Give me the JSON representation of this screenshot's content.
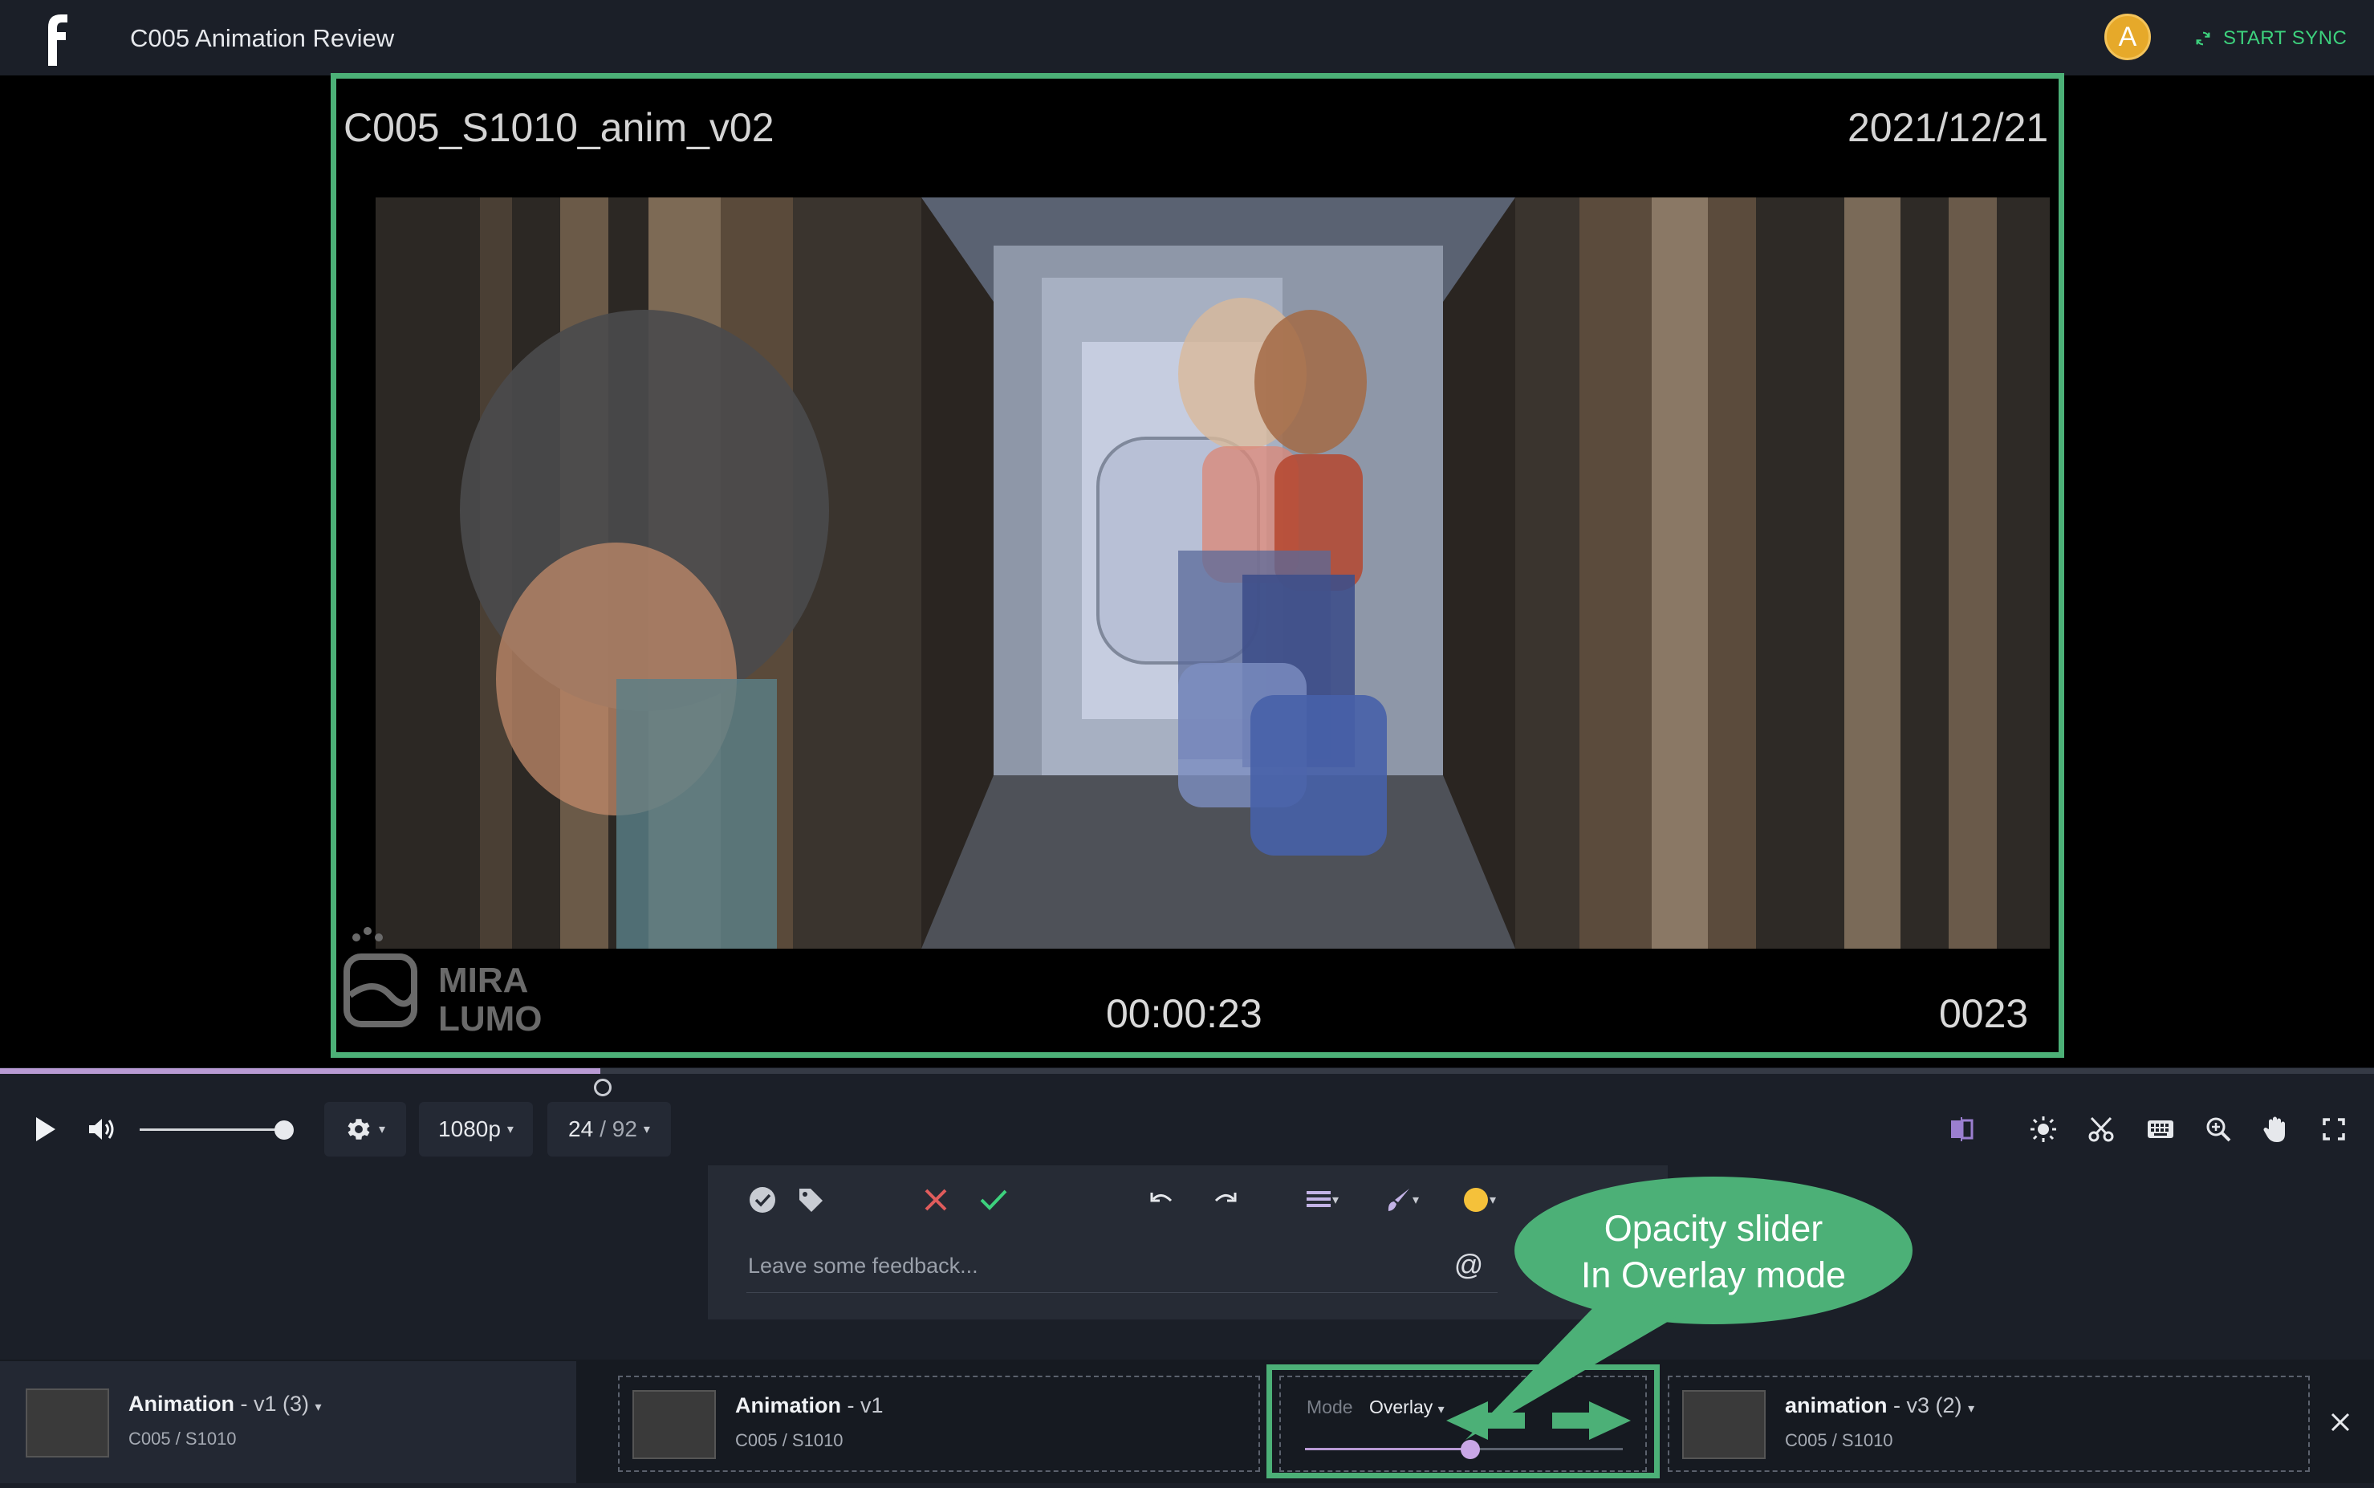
{
  "header": {
    "app_title": "C005 Animation Review",
    "avatar_letter": "A",
    "sync_label": "START SYNC"
  },
  "viewer": {
    "shot_name": "C005_S1010_anim_v02",
    "date": "2021/12/21",
    "timecode": "00:00:23",
    "frame_counter": "0023",
    "watermark": "MIRA LUMO"
  },
  "timeline": {
    "progress_fraction": 0.253
  },
  "controls": {
    "volume_fraction": 1.0,
    "quality": "1080p",
    "frame_current": "24",
    "frame_total": "/ 92",
    "icons": [
      "play-icon",
      "volume-icon",
      "gear-icon",
      "compare-icon",
      "brightness-icon",
      "scissors-icon",
      "keyboard-icon",
      "zoom-icon",
      "hand-icon",
      "fullscreen-icon"
    ]
  },
  "feedback": {
    "placeholder": "Leave some feedback...",
    "at_symbol": "@",
    "color_swatch": "#f5c13a",
    "icons": [
      "approve-circle-icon",
      "tag-icon",
      "reject-icon",
      "accept-icon",
      "undo-icon",
      "redo-icon",
      "line-weight-icon",
      "brush-icon",
      "color-icon"
    ]
  },
  "callout": {
    "line1": "Opacity slider",
    "line2": "In Overlay mode"
  },
  "versions": {
    "current": {
      "title": "Animation",
      "version": "- v1 (3)",
      "path": "C005 / S1010"
    },
    "compare_a": {
      "title": "Animation",
      "version": "- v1",
      "path": "C005 / S1010"
    },
    "compare_b": {
      "title": "animation",
      "version": "- v3 (2)",
      "path": "C005 / S1010"
    }
  },
  "compare_mode": {
    "label": "Mode",
    "value": "Overlay",
    "opacity_fraction": 0.52
  },
  "colors": {
    "accent_green": "#4cb077",
    "sync_green": "#3dd17d",
    "timeline_purple": "#b89ad4",
    "avatar_gold": "#e6a92a"
  }
}
